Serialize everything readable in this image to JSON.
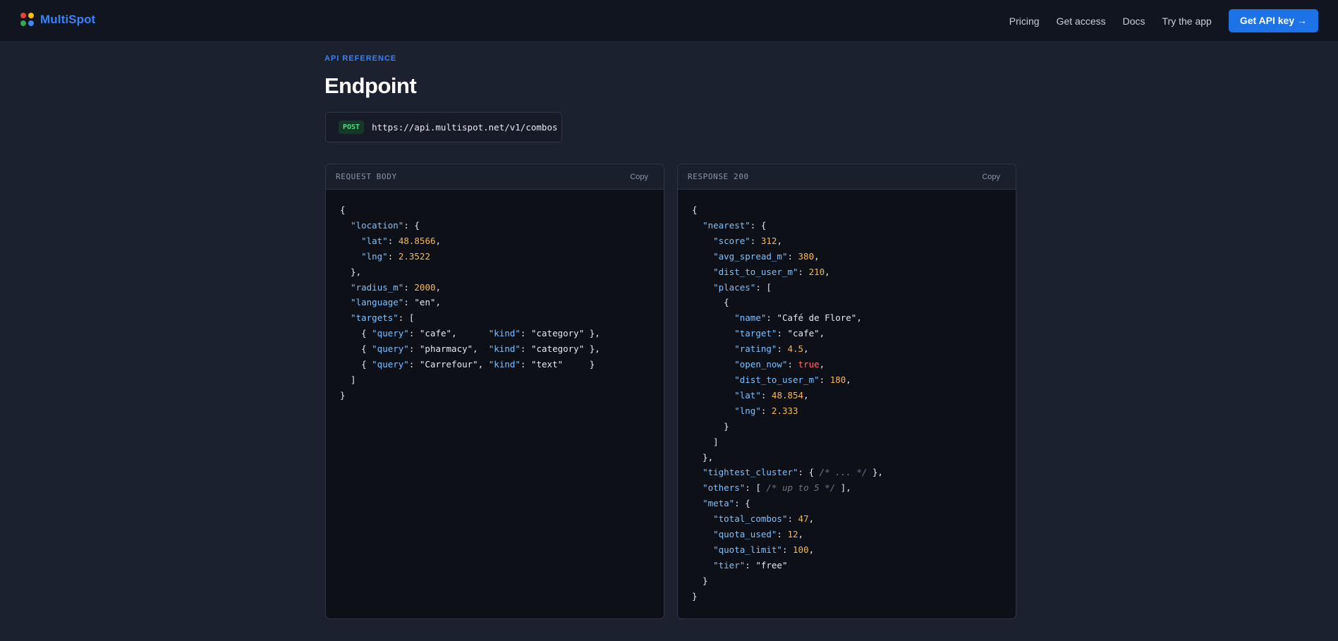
{
  "brand": {
    "name": "MultiSpot"
  },
  "nav": {
    "items": [
      "Pricing",
      "Get access",
      "Docs",
      "Try the app"
    ],
    "cta_label": "Get API key →"
  },
  "header": {
    "eyebrow": "API REFERENCE",
    "title": "Endpoint"
  },
  "endpoint": {
    "method": "POST",
    "url": "https://api.multispot.net/v1/combos"
  },
  "request_panel": {
    "title": "REQUEST BODY",
    "copy_label": "Copy"
  },
  "response_panel": {
    "title": "RESPONSE 200",
    "copy_label": "Copy"
  },
  "request_code": [
    [
      [
        "p",
        "{"
      ]
    ],
    [
      [
        "p",
        "  "
      ],
      [
        "k",
        "\"location\""
      ],
      [
        "p",
        ": {"
      ]
    ],
    [
      [
        "p",
        "    "
      ],
      [
        "k",
        "\"lat\""
      ],
      [
        "p",
        ": "
      ],
      [
        "n",
        "48.8566"
      ],
      [
        "p",
        ","
      ]
    ],
    [
      [
        "p",
        "    "
      ],
      [
        "k",
        "\"lng\""
      ],
      [
        "p",
        ": "
      ],
      [
        "n",
        "2.3522"
      ]
    ],
    [
      [
        "p",
        "  },"
      ]
    ],
    [
      [
        "p",
        "  "
      ],
      [
        "k",
        "\"radius_m\""
      ],
      [
        "p",
        ": "
      ],
      [
        "n",
        "2000"
      ],
      [
        "p",
        ","
      ]
    ],
    [
      [
        "p",
        "  "
      ],
      [
        "k",
        "\"language\""
      ],
      [
        "p",
        ": "
      ],
      [
        "s",
        "\"en\""
      ],
      [
        "p",
        ","
      ]
    ],
    [
      [
        "p",
        "  "
      ],
      [
        "k",
        "\"targets\""
      ],
      [
        "p",
        ": ["
      ]
    ],
    [
      [
        "p",
        "    { "
      ],
      [
        "k",
        "\"query\""
      ],
      [
        "p",
        ": "
      ],
      [
        "s",
        "\"cafe\""
      ],
      [
        "p",
        ",      "
      ],
      [
        "k",
        "\"kind\""
      ],
      [
        "p",
        ": "
      ],
      [
        "s",
        "\"category\""
      ],
      [
        "p",
        " },"
      ]
    ],
    [
      [
        "p",
        "    { "
      ],
      [
        "k",
        "\"query\""
      ],
      [
        "p",
        ": "
      ],
      [
        "s",
        "\"pharmacy\""
      ],
      [
        "p",
        ",  "
      ],
      [
        "k",
        "\"kind\""
      ],
      [
        "p",
        ": "
      ],
      [
        "s",
        "\"category\""
      ],
      [
        "p",
        " },"
      ]
    ],
    [
      [
        "p",
        "    { "
      ],
      [
        "k",
        "\"query\""
      ],
      [
        "p",
        ": "
      ],
      [
        "s",
        "\"Carrefour\""
      ],
      [
        "p",
        ", "
      ],
      [
        "k",
        "\"kind\""
      ],
      [
        "p",
        ": "
      ],
      [
        "s",
        "\"text\""
      ],
      [
        "p",
        "     }"
      ]
    ],
    [
      [
        "p",
        "  ]"
      ]
    ],
    [
      [
        "p",
        "}"
      ]
    ]
  ],
  "response_code": [
    [
      [
        "p",
        "{"
      ]
    ],
    [
      [
        "p",
        "  "
      ],
      [
        "k",
        "\"nearest\""
      ],
      [
        "p",
        ": {"
      ]
    ],
    [
      [
        "p",
        "    "
      ],
      [
        "k",
        "\"score\""
      ],
      [
        "p",
        ": "
      ],
      [
        "n",
        "312"
      ],
      [
        "p",
        ","
      ]
    ],
    [
      [
        "p",
        "    "
      ],
      [
        "k",
        "\"avg_spread_m\""
      ],
      [
        "p",
        ": "
      ],
      [
        "n",
        "380"
      ],
      [
        "p",
        ","
      ]
    ],
    [
      [
        "p",
        "    "
      ],
      [
        "k",
        "\"dist_to_user_m\""
      ],
      [
        "p",
        ": "
      ],
      [
        "n",
        "210"
      ],
      [
        "p",
        ","
      ]
    ],
    [
      [
        "p",
        "    "
      ],
      [
        "k",
        "\"places\""
      ],
      [
        "p",
        ": ["
      ]
    ],
    [
      [
        "p",
        "      {"
      ]
    ],
    [
      [
        "p",
        "        "
      ],
      [
        "k",
        "\"name\""
      ],
      [
        "p",
        ": "
      ],
      [
        "s",
        "\"Café de Flore\""
      ],
      [
        "p",
        ","
      ]
    ],
    [
      [
        "p",
        "        "
      ],
      [
        "k",
        "\"target\""
      ],
      [
        "p",
        ": "
      ],
      [
        "s",
        "\"cafe\""
      ],
      [
        "p",
        ","
      ]
    ],
    [
      [
        "p",
        "        "
      ],
      [
        "k",
        "\"rating\""
      ],
      [
        "p",
        ": "
      ],
      [
        "n",
        "4.5"
      ],
      [
        "p",
        ","
      ]
    ],
    [
      [
        "p",
        "        "
      ],
      [
        "k",
        "\"open_now\""
      ],
      [
        "p",
        ": "
      ],
      [
        "b",
        "true"
      ],
      [
        "p",
        ","
      ]
    ],
    [
      [
        "p",
        "        "
      ],
      [
        "k",
        "\"dist_to_user_m\""
      ],
      [
        "p",
        ": "
      ],
      [
        "n",
        "180"
      ],
      [
        "p",
        ","
      ]
    ],
    [
      [
        "p",
        "        "
      ],
      [
        "k",
        "\"lat\""
      ],
      [
        "p",
        ": "
      ],
      [
        "n",
        "48.854"
      ],
      [
        "p",
        ","
      ]
    ],
    [
      [
        "p",
        "        "
      ],
      [
        "k",
        "\"lng\""
      ],
      [
        "p",
        ": "
      ],
      [
        "n",
        "2.333"
      ]
    ],
    [
      [
        "p",
        "      }"
      ]
    ],
    [
      [
        "p",
        "    ]"
      ]
    ],
    [
      [
        "p",
        "  },"
      ]
    ],
    [
      [
        "p",
        "  "
      ],
      [
        "k",
        "\"tightest_cluster\""
      ],
      [
        "p",
        ": { "
      ],
      [
        "c",
        "/* ... */"
      ],
      [
        "p",
        " },"
      ]
    ],
    [
      [
        "p",
        "  "
      ],
      [
        "k",
        "\"others\""
      ],
      [
        "p",
        ": [ "
      ],
      [
        "c",
        "/* up to 5 */"
      ],
      [
        "p",
        " ],"
      ]
    ],
    [
      [
        "p",
        "  "
      ],
      [
        "k",
        "\"meta\""
      ],
      [
        "p",
        ": {"
      ]
    ],
    [
      [
        "p",
        "    "
      ],
      [
        "k",
        "\"total_combos\""
      ],
      [
        "p",
        ": "
      ],
      [
        "n",
        "47"
      ],
      [
        "p",
        ","
      ]
    ],
    [
      [
        "p",
        "    "
      ],
      [
        "k",
        "\"quota_used\""
      ],
      [
        "p",
        ": "
      ],
      [
        "n",
        "12"
      ],
      [
        "p",
        ","
      ]
    ],
    [
      [
        "p",
        "    "
      ],
      [
        "k",
        "\"quota_limit\""
      ],
      [
        "p",
        ": "
      ],
      [
        "n",
        "100"
      ],
      [
        "p",
        ","
      ]
    ],
    [
      [
        "p",
        "    "
      ],
      [
        "k",
        "\"tier\""
      ],
      [
        "p",
        ": "
      ],
      [
        "s",
        "\"free\""
      ]
    ],
    [
      [
        "p",
        "  }"
      ]
    ],
    [
      [
        "p",
        "}"
      ]
    ]
  ]
}
